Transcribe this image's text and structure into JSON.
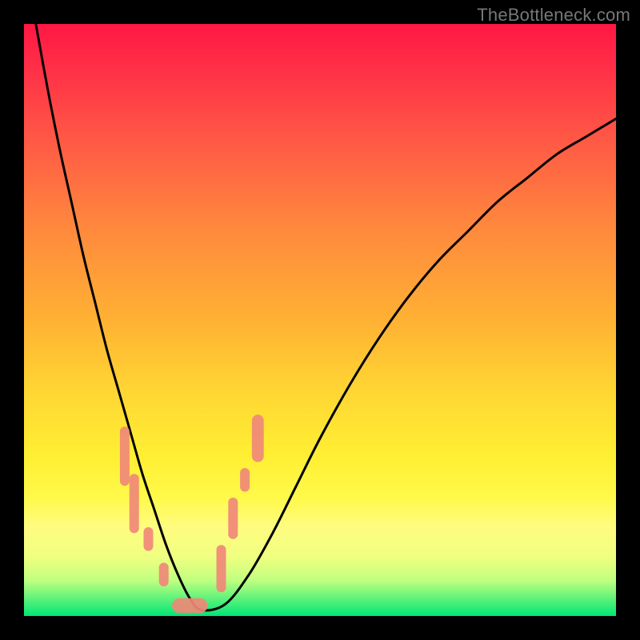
{
  "watermark": "TheBottleneck.com",
  "chart_data": {
    "type": "line",
    "title": "",
    "xlabel": "",
    "ylabel": "",
    "xlim": [
      0,
      100
    ],
    "ylim": [
      0,
      100
    ],
    "series": [
      {
        "name": "bottleneck-curve",
        "x": [
          2,
          4,
          6,
          8,
          10,
          12,
          14,
          16,
          18,
          20,
          22,
          24,
          26,
          28,
          30,
          34,
          38,
          42,
          46,
          50,
          55,
          60,
          65,
          70,
          75,
          80,
          85,
          90,
          95,
          100
        ],
        "values": [
          100,
          89,
          79,
          70,
          61,
          53,
          45,
          38,
          31,
          24,
          18,
          12,
          7,
          3,
          1,
          2,
          7,
          14,
          22,
          30,
          39,
          47,
          54,
          60,
          65,
          70,
          74,
          78,
          81,
          84
        ]
      }
    ],
    "markers": [
      {
        "x_range": [
          16.2,
          17.6
        ],
        "y_range": [
          22,
          32
        ],
        "shape": "pill"
      },
      {
        "x_range": [
          17.8,
          19.4
        ],
        "y_range": [
          14,
          24
        ],
        "shape": "pill"
      },
      {
        "x_range": [
          20.2,
          21.4
        ],
        "y_range": [
          11,
          15
        ],
        "shape": "dot"
      },
      {
        "x_range": [
          22.8,
          24.0
        ],
        "y_range": [
          5,
          9
        ],
        "shape": "dot"
      },
      {
        "x_range": [
          25.0,
          31.0
        ],
        "y_range": [
          0.5,
          3
        ],
        "shape": "bar"
      },
      {
        "x_range": [
          32.5,
          34.0
        ],
        "y_range": [
          4,
          12
        ],
        "shape": "pill"
      },
      {
        "x_range": [
          34.5,
          36.0
        ],
        "y_range": [
          13,
          20
        ],
        "shape": "pill"
      },
      {
        "x_range": [
          36.5,
          38.0
        ],
        "y_range": [
          21,
          25
        ],
        "shape": "dot"
      },
      {
        "x_range": [
          38.5,
          40.5
        ],
        "y_range": [
          26,
          34
        ],
        "shape": "pill"
      }
    ],
    "background_gradient": {
      "top": "#ff1744",
      "mid": "#ffd633",
      "bottom": "#00e676"
    }
  }
}
